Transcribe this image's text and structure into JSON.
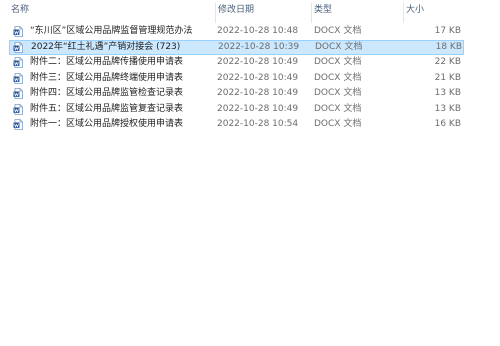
{
  "columns": {
    "name": "名称",
    "date": "修改日期",
    "type": "类型",
    "size": "大小"
  },
  "files": [
    {
      "name": "“东川区”区域公用品牌监督管理规范办法",
      "date": "2022-10-28 10:48",
      "type": "DOCX 文档",
      "size": "17 KB",
      "icon": "docx-file-icon",
      "selected": false
    },
    {
      "name": "2022年“红土礼遇”产销对接会 (723)",
      "date": "2022-10-28 10:39",
      "type": "DOCX 文档",
      "size": "18 KB",
      "icon": "docx-file-icon",
      "selected": true
    },
    {
      "name": "附件二：区域公用品牌传播使用申请表",
      "date": "2022-10-28 10:49",
      "type": "DOCX 文档",
      "size": "22 KB",
      "icon": "docx-file-icon",
      "selected": false
    },
    {
      "name": "附件三：区域公用品牌终端使用申请表",
      "date": "2022-10-28 10:49",
      "type": "DOCX 文档",
      "size": "21 KB",
      "icon": "docx-file-icon",
      "selected": false
    },
    {
      "name": "附件四：区域公用品牌监管检查记录表",
      "date": "2022-10-28 10:49",
      "type": "DOCX 文档",
      "size": "13 KB",
      "icon": "docx-file-icon",
      "selected": false
    },
    {
      "name": "附件五：区域公用品牌监管复查记录表",
      "date": "2022-10-28 10:49",
      "type": "DOCX 文档",
      "size": "13 KB",
      "icon": "docx-file-icon",
      "selected": false
    },
    {
      "name": "附件一：区域公用品牌授权使用申请表",
      "date": "2022-10-28 10:54",
      "type": "DOCX 文档",
      "size": "16 KB",
      "icon": "docx-file-icon",
      "selected": false
    }
  ],
  "colors": {
    "selection_fill": "#cce8ff",
    "selection_border": "#99d1ff",
    "header_text": "#4c607a",
    "icon_blue": "#2b579a"
  }
}
